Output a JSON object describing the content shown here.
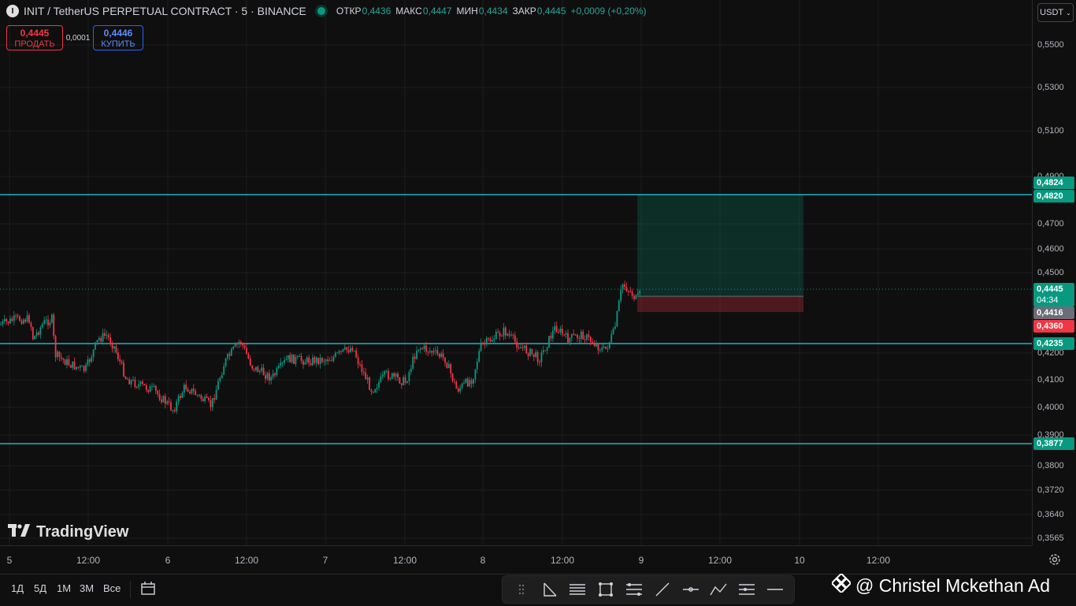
{
  "header": {
    "symbol_icon": "I",
    "title": "INIT / TetherUS PERPETUAL CONTRACT · 5 · BINANCE",
    "ohlc": [
      {
        "key": "ОТКР",
        "value": "0,4436"
      },
      {
        "key": "МАКС",
        "value": "0,4447"
      },
      {
        "key": "МИН",
        "value": "0,4434"
      },
      {
        "key": "ЗАКР",
        "value": "0,4445"
      }
    ],
    "change": "+0,0009 (+0,20%)"
  },
  "trade": {
    "sell_price": "0,4445",
    "sell_label": "ПРОДАТЬ",
    "spread": "0,0001",
    "buy_price": "0,4446",
    "buy_label": "КУПИТЬ"
  },
  "currency_button": "USDT",
  "price_axis": {
    "labels": [
      "0,5500",
      "0,5300",
      "0,5100",
      "0,4900",
      "0,4700",
      "0,4600",
      "0,4500",
      "0,4200",
      "0,4100",
      "0,4000",
      "0,3900",
      "0,3800",
      "0,3720",
      "0,3640",
      "0,3565"
    ],
    "tags": [
      {
        "text": "0,4824",
        "color": "#089981"
      },
      {
        "text": "0,4820",
        "color": "#089981"
      },
      {
        "text": "0,4445",
        "color": "#089981"
      },
      {
        "text": "04:34",
        "color": "#089981"
      },
      {
        "text": "0,4416",
        "color": "#6a6d78"
      },
      {
        "text": "0,4360",
        "color": "#f23645"
      },
      {
        "text": "0,4235",
        "color": "#089981"
      },
      {
        "text": "0,3877",
        "color": "#089981"
      }
    ]
  },
  "time_axis": {
    "labels": [
      "5",
      "12:00",
      "6",
      "12:00",
      "7",
      "12:00",
      "8",
      "12:00",
      "9",
      "12:00",
      "10",
      "12:00"
    ]
  },
  "logo_text": "TradingView",
  "timeframes": [
    "1Д",
    "5Д",
    "1М",
    "3М",
    "Все"
  ],
  "toolbar_icons": [
    "drag-handle-icon",
    "measure-icon",
    "horizontal-lines-icon",
    "rectangle-icon",
    "fib-icon",
    "trend-line-icon",
    "horizontal-ray-icon",
    "path-icon",
    "parallel-channel-icon",
    "horizontal-line-icon"
  ],
  "watermark": "@ Christel Mckethan Ad",
  "colors": {
    "up": "#089981",
    "down": "#f23645",
    "level": "#22b3c4",
    "bg": "#0f0f0f"
  },
  "levels": [
    "0,4820",
    "0,4235",
    "0,3877"
  ]
}
